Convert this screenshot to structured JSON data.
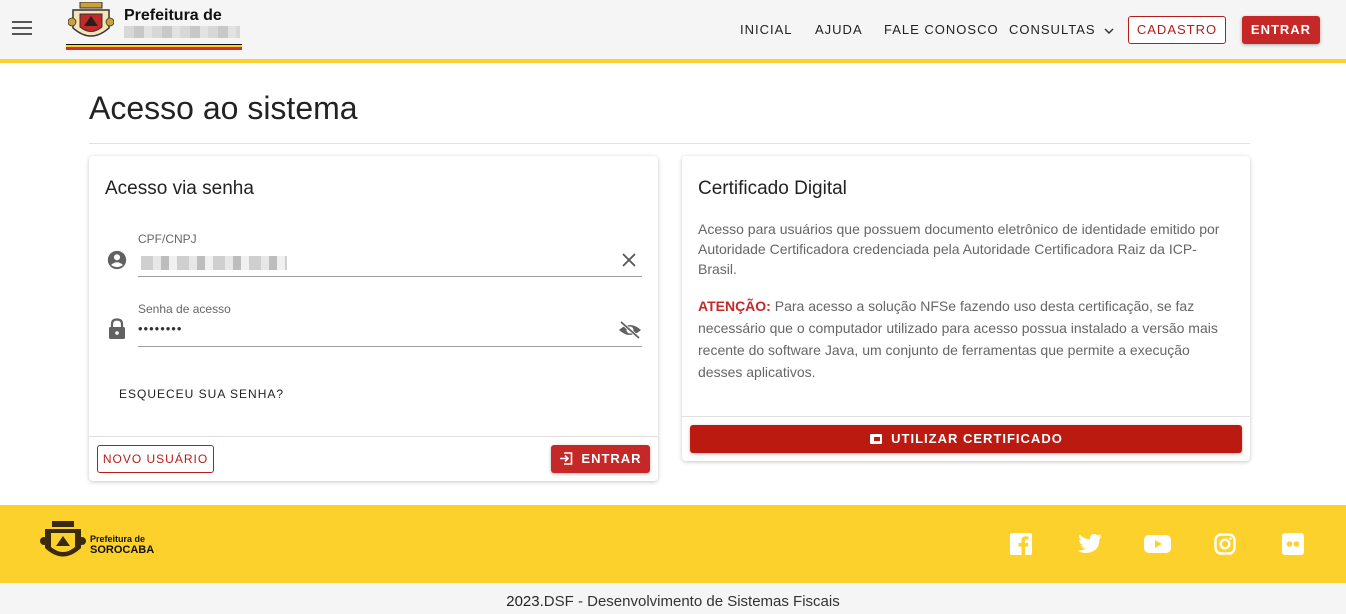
{
  "header": {
    "logo_title": "Prefeitura de",
    "nav": {
      "inicial": "INICIAL",
      "ajuda": "AJUDA",
      "fale_conosco": "FALE CONOSCO",
      "consultas": "CONSULTAS"
    },
    "cadastro_label": "CADASTRO",
    "entrar_label": "ENTRAR"
  },
  "main": {
    "page_title": "Acesso ao sistema"
  },
  "login_card": {
    "title": "Acesso via senha",
    "cpf_label": "CPF/CNPJ",
    "password_label": "Senha de acesso",
    "password_value": "••••••••",
    "forgot_label": "ESQUECEU SUA SENHA?",
    "new_user_label": "NOVO USUÁRIO",
    "submit_label": "ENTRAR"
  },
  "cert_card": {
    "title": "Certificado Digital",
    "description": "Acesso para usuários que possuem documento eletrônico de identidade emitido por Autoridade Certificadora credenciada pela Autoridade Certificadora Raiz da ICP-Brasil.",
    "attention_label": "ATENÇÃO:",
    "attention_text": "Para acesso a solução NFSe fazendo uso desta certificação, se faz necessário que o computador utilizado para acesso possua instalado a versão mais recente do software Java, um conjunto de ferramentas que permite a execução desses aplicativos.",
    "button_label": "UTILIZAR CERTIFICADO"
  },
  "footer": {
    "logo_title": "Prefeitura de",
    "logo_city": "SOROCABA",
    "social_icons": [
      "facebook-icon",
      "twitter-icon",
      "youtube-icon",
      "instagram-icon",
      "flickr-icon"
    ],
    "copyright_year": "2023.",
    "copyright_text": "DSF - Desenvolvimento de Sistemas Fiscais"
  },
  "colors": {
    "accent_yellow": "#fdd12b",
    "accent_red": "#c62828"
  }
}
